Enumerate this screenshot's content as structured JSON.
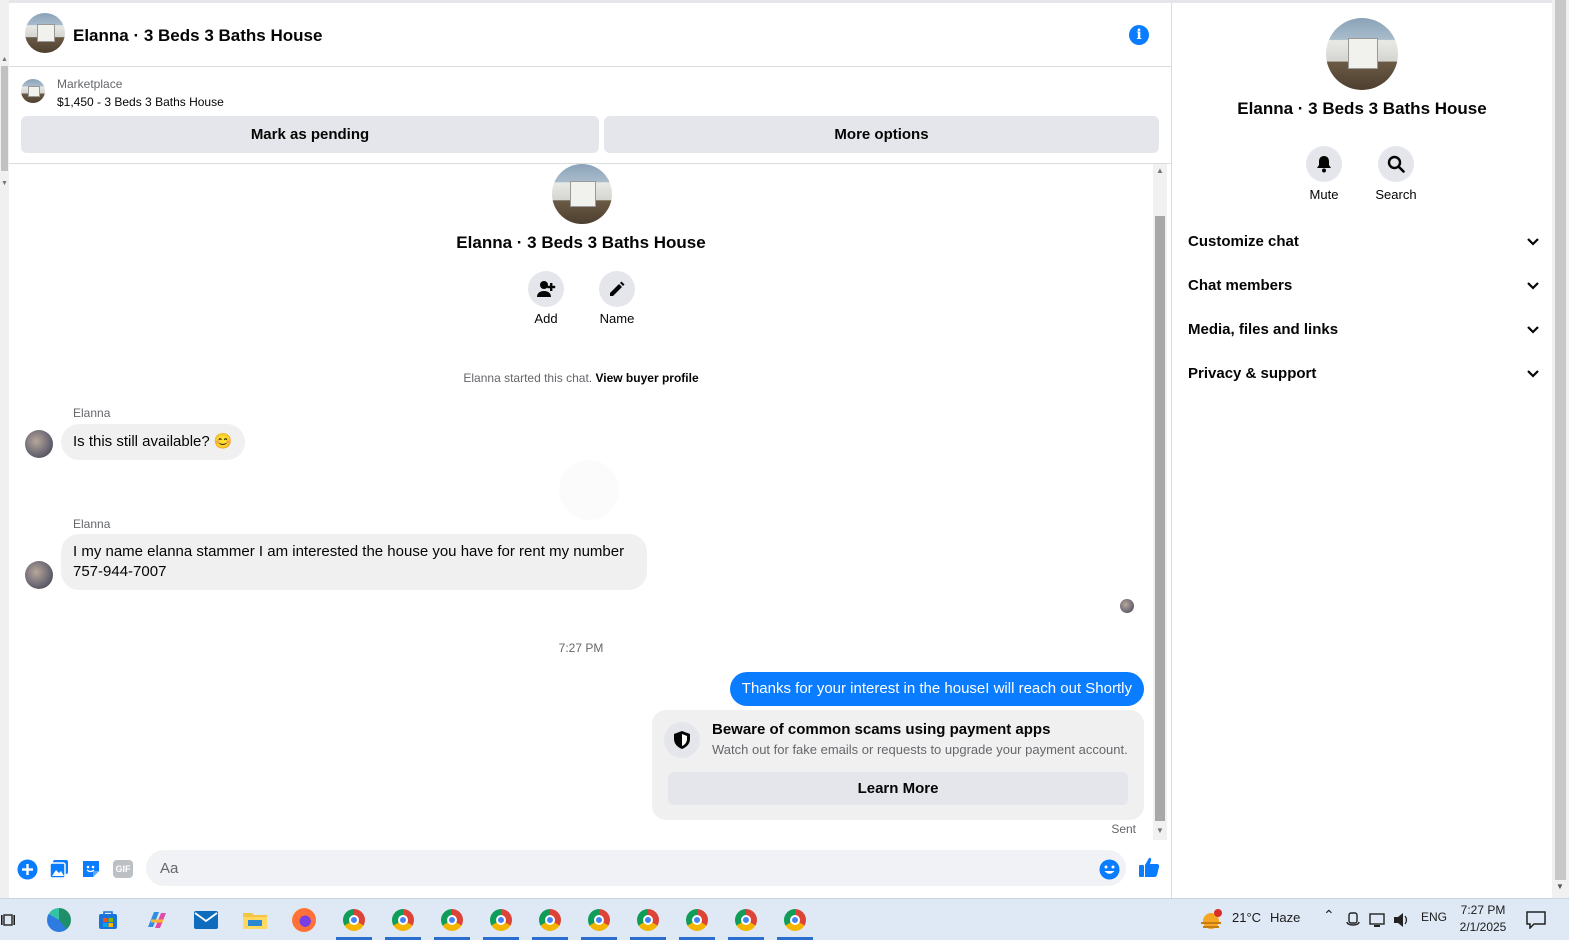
{
  "header": {
    "title": "Elanna · 3 Beds 3 Baths House",
    "info_icon": "info-icon"
  },
  "marketplace": {
    "label": "Marketplace",
    "listing": "$1,450 - 3 Beds 3 Baths House",
    "mark_pending": "Mark as pending",
    "more_options": "More options"
  },
  "conversation": {
    "name": "Elanna · 3 Beds 3 Baths House",
    "add_label": "Add",
    "name_label": "Name",
    "started_text": "Elanna started this chat.",
    "view_profile": "View buyer profile",
    "messages": [
      {
        "sender": "Elanna",
        "text": "Is this still available? 😊"
      },
      {
        "sender": "Elanna",
        "text": "I my name elanna stammer I am interested the house you have for rent my number 757-944-7007"
      }
    ],
    "timestamp": "7:27 PM",
    "outgoing": "Thanks for your interest in the houseI will reach out Shortly",
    "scam_card": {
      "title": "Beware of common scams using payment apps",
      "subtitle": "Watch out for fake emails or requests to upgrade your payment account.",
      "button": "Learn More"
    },
    "status": "Sent"
  },
  "composer": {
    "placeholder": "Aa",
    "icons": [
      "plus-icon",
      "image-icon",
      "sticker-icon",
      "gif-icon",
      "emoji-icon",
      "like-icon"
    ],
    "gif_label": "GIF"
  },
  "right_panel": {
    "name": "Elanna · 3 Beds 3 Baths House",
    "mute": "Mute",
    "search": "Search",
    "sections": [
      "Customize chat",
      "Chat members",
      "Media, files and links",
      "Privacy & support"
    ]
  },
  "taskbar": {
    "weather_temp": "21°C",
    "weather_desc": "Haze",
    "language": "ENG",
    "time": "7:27 PM",
    "date": "2/1/2025"
  },
  "colors": {
    "accent": "#0a7cff",
    "bubble_in": "#f0f0f0",
    "button_gray": "#e4e6eb"
  }
}
